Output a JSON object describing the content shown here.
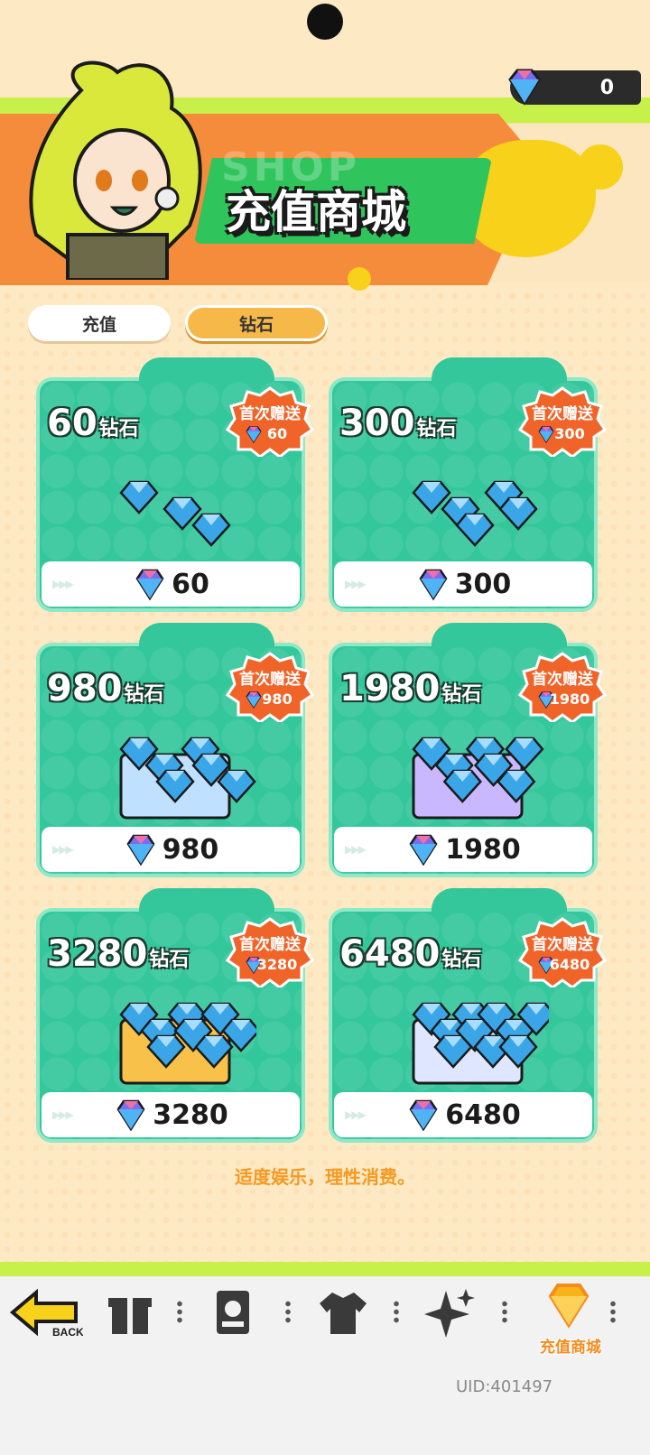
{
  "currency": {
    "balance": "0",
    "icon": "diamond-icon"
  },
  "banner": {
    "watermark": "SHOP",
    "title": "充值商城"
  },
  "tabs": [
    {
      "label": "充值",
      "selected": false
    },
    {
      "label": "钻石",
      "selected": true
    }
  ],
  "cards": [
    {
      "amount": "60",
      "unit": "钻石",
      "badge_label": "首次赠送",
      "badge_value": "60",
      "price": "60"
    },
    {
      "amount": "300",
      "unit": "钻石",
      "badge_label": "首次赠送",
      "badge_value": "300",
      "price": "300"
    },
    {
      "amount": "980",
      "unit": "钻石",
      "badge_label": "首次赠送",
      "badge_value": "980",
      "price": "980"
    },
    {
      "amount": "1980",
      "unit": "钻石",
      "badge_label": "首次赠送",
      "badge_value": "1980",
      "price": "1980"
    },
    {
      "amount": "3280",
      "unit": "钻石",
      "badge_label": "首次赠送",
      "badge_value": "3280",
      "price": "3280"
    },
    {
      "amount": "6480",
      "unit": "钻石",
      "badge_label": "首次赠送",
      "badge_value": "6480",
      "price": "6480"
    }
  ],
  "notice": "适度娱乐，理性消费。",
  "bottom_nav": {
    "back_label": "BACK",
    "items": [
      "back-icon",
      "gift-icon",
      "card-icon",
      "shirt-icon",
      "sparkle-icon",
      "shop-icon"
    ],
    "shop_label": "充值商城"
  },
  "uid": "UID:401497",
  "colors": {
    "card": "#35c79c",
    "accent": "#f58c3b",
    "lime": "#c8f04a",
    "badge": "#f0642a"
  }
}
